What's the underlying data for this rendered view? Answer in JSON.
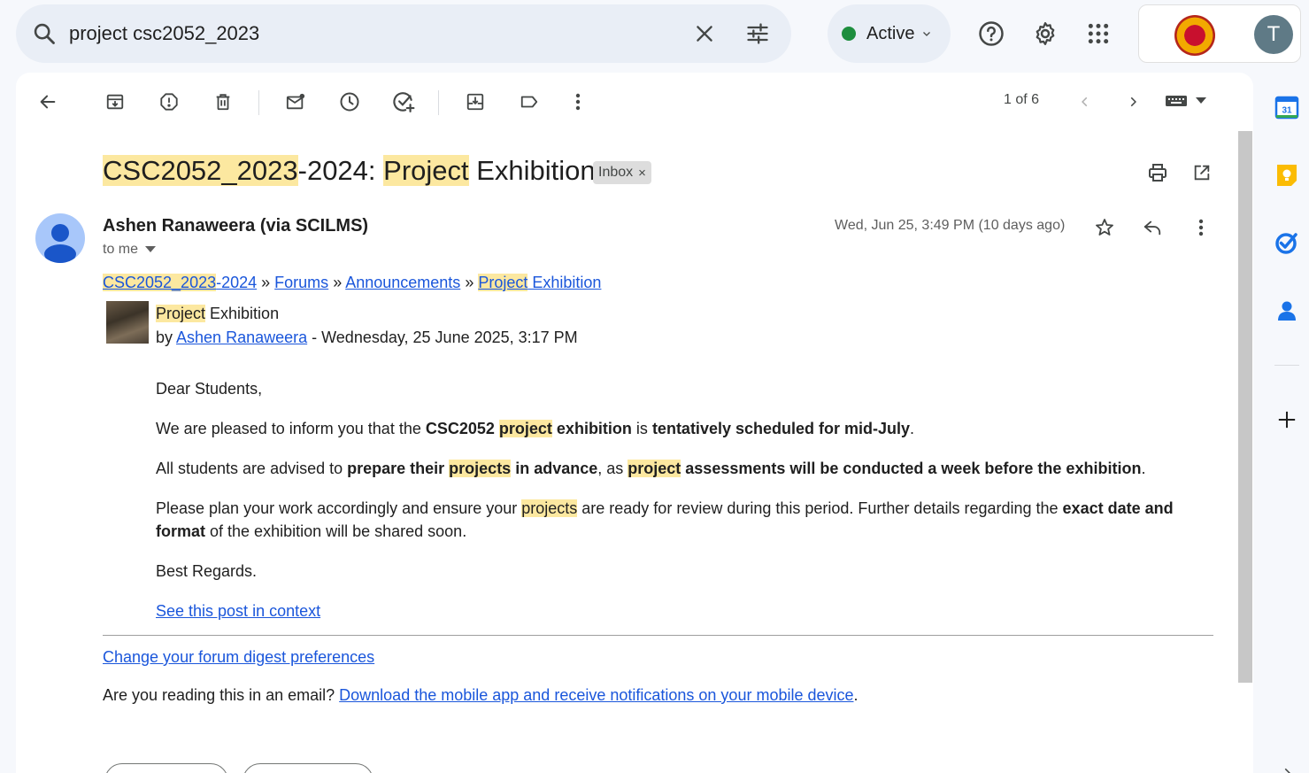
{
  "search": {
    "query": "project csc2052_2023"
  },
  "status": {
    "label": "Active"
  },
  "account": {
    "initial": "T"
  },
  "toolbar": {
    "pager": "1 of 6"
  },
  "email": {
    "subject_parts": [
      "CSC2052_2023",
      "-2024: ",
      "Project",
      " Exhibition"
    ],
    "label_chip": "Inbox",
    "label_chip_close": "×",
    "sender": "Ashen Ranaweera (via SCILMS)",
    "to": "to me",
    "date": "Wed, Jun 25, 3:49 PM (10 days ago)",
    "breadcrumb": {
      "course_hl": "CSC2052_2023",
      "course_rest": "-2024",
      "sep": " » ",
      "forums": "Forums",
      "announcements": "Announcements",
      "post_hl": "Project",
      "post_rest": " Exhibition"
    },
    "post": {
      "title_hl": "Project",
      "title_rest": " Exhibition",
      "by_prefix": "by ",
      "author": "Ashen Ranaweera",
      "posted": " - Wednesday, 25 June 2025, 3:17 PM"
    },
    "body": {
      "greeting": "Dear Students,",
      "p1": [
        "We are pleased to inform you that the ",
        "CSC2052",
        " ",
        "project",
        " exhibition",
        " is ",
        "tentatively scheduled for mid-July",
        "."
      ],
      "p2": [
        "All students are advised to ",
        "prepare their ",
        "projects",
        " in advance",
        ", as ",
        "project",
        " assessments will be conducted a week before the exhibition",
        "."
      ],
      "p3": [
        "Please plan your work accordingly and ensure your ",
        "projects",
        " are ready for review during this period. Further details regarding the ",
        "exact date and format",
        " of the exhibition will be shared soon."
      ],
      "signoff": "Best Regards.",
      "context_link": "See this post in context"
    },
    "footer": {
      "digest_link": "Change your forum digest preferences",
      "question": "Are you reading this in an email? ",
      "app_link": "Download the mobile app and receive notifications on your mobile device",
      "end": "."
    }
  },
  "side": {
    "calendar_day": "31"
  },
  "colors": {
    "highlight": "#fce8a0",
    "link": "#1a56db",
    "active_dot": "#1e8e3e"
  }
}
